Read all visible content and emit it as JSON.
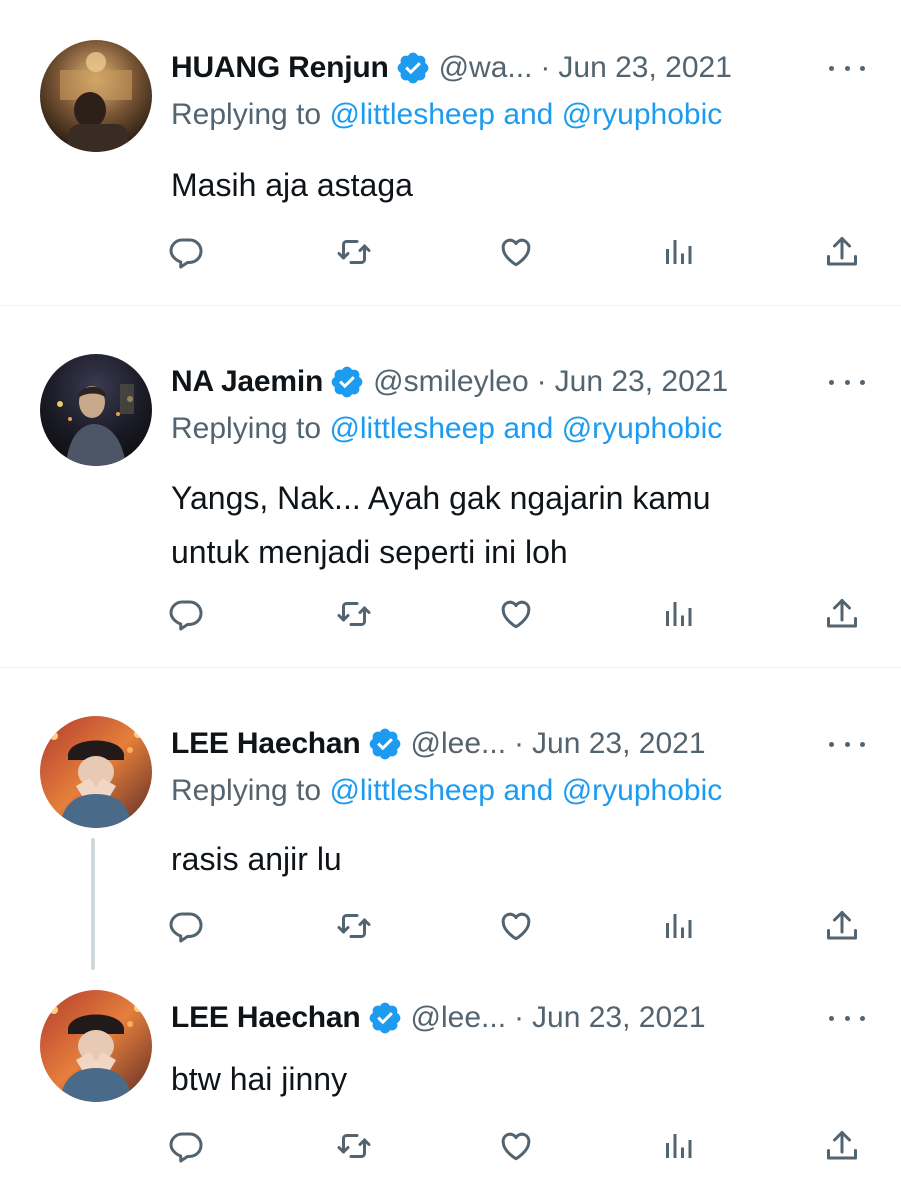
{
  "colors": {
    "accent": "#1d9bf0",
    "text": "#0f1419",
    "secondary": "#536471",
    "divider": "#eff3f4",
    "thread_line": "#cfd9de"
  },
  "tweets": [
    {
      "name": "HUANG Renjun",
      "handle": "@wa...",
      "separator": "·",
      "date": "Jun 23, 2021",
      "replying_prefix": "Replying to",
      "reply_mentions": "@littlesheep and @ryuphobic",
      "text_lines": [
        "Masih aja astaga"
      ],
      "icons": [
        "verified-badge-icon",
        "reply-icon",
        "retweet-icon",
        "like-icon",
        "views-icon",
        "share-icon",
        "more-icon"
      ]
    },
    {
      "name": "NA Jaemin",
      "handle": "@smileyleo",
      "separator": "·",
      "date": "Jun 23, 2021",
      "replying_prefix": "Replying to",
      "reply_mentions": "@littlesheep and @ryuphobic",
      "text_lines": [
        "Yangs, Nak... Ayah gak ngajarin kamu",
        "untuk menjadi seperti ini loh"
      ],
      "icons": [
        "verified-badge-icon",
        "reply-icon",
        "retweet-icon",
        "like-icon",
        "views-icon",
        "share-icon",
        "more-icon"
      ]
    },
    {
      "name": "LEE Haechan",
      "handle": "@lee...",
      "separator": "·",
      "date": "Jun 23, 2021",
      "replying_prefix": "Replying to",
      "reply_mentions": "@littlesheep and @ryuphobic",
      "text_lines": [
        "rasis anjir lu"
      ],
      "icons": [
        "verified-badge-icon",
        "reply-icon",
        "retweet-icon",
        "like-icon",
        "views-icon",
        "share-icon",
        "more-icon"
      ]
    },
    {
      "name": "LEE Haechan",
      "handle": "@lee...",
      "separator": "·",
      "date": "Jun 23, 2021",
      "text_lines": [
        "btw hai jinny"
      ],
      "icons": [
        "verified-badge-icon",
        "reply-icon",
        "retweet-icon",
        "like-icon",
        "views-icon",
        "share-icon",
        "more-icon"
      ]
    }
  ]
}
